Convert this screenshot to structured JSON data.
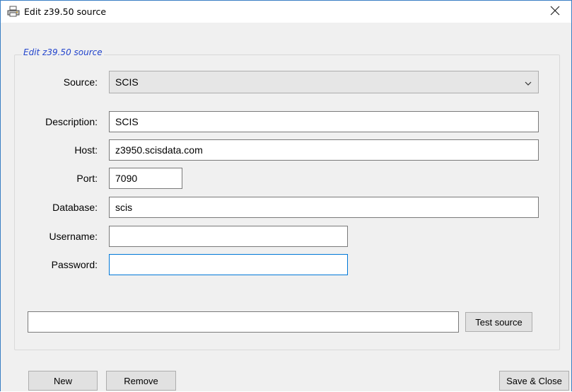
{
  "window": {
    "title": "Edit z39.50 source"
  },
  "group": {
    "legend": "Edit z39.50 source"
  },
  "form": {
    "source_label": "Source:",
    "source_value": "SCIS",
    "description_label": "Description:",
    "description_value": "SCIS",
    "host_label": "Host:",
    "host_value": "z3950.scisdata.com",
    "port_label": "Port:",
    "port_value": "7090",
    "database_label": "Database:",
    "database_value": "scis",
    "username_label": "Username:",
    "username_value": "",
    "password_label": "Password:",
    "password_value": ""
  },
  "test": {
    "status_value": "",
    "button_label": "Test source"
  },
  "footer": {
    "new_label": "New",
    "remove_label": "Remove",
    "save_close_label": "Save & Close"
  },
  "icons": {
    "title": "printer-icon",
    "close": "close-icon",
    "dropdown": "chevron-down-icon"
  },
  "colors": {
    "accent": "#0078d7",
    "legend": "#2244cc",
    "window_border": "#3a7fc4"
  }
}
